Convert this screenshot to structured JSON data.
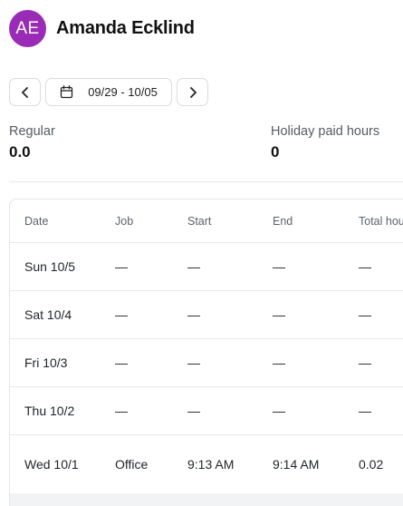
{
  "employee": {
    "initials": "AE",
    "name": "Amanda Ecklind",
    "avatar_color": "#9a2bb7"
  },
  "date_nav": {
    "prev_icon": "chevron-left-icon",
    "next_icon": "chevron-right-icon",
    "calendar_icon": "calendar-icon",
    "range": "09/29 - 10/05"
  },
  "summary": {
    "regular_label": "Regular",
    "regular_value": "0.0",
    "holiday_label": "Holiday paid hours",
    "holiday_value": "0"
  },
  "table": {
    "columns": [
      "Date",
      "Job",
      "Start",
      "End",
      "Total hou"
    ],
    "rows": [
      {
        "date": "Sun 10/5",
        "job": "—",
        "start": "—",
        "end": "—",
        "total": "—"
      },
      {
        "date": "Sat 10/4",
        "job": "—",
        "start": "—",
        "end": "—",
        "total": "—"
      },
      {
        "date": "Fri 10/3",
        "job": "—",
        "start": "—",
        "end": "—",
        "total": "—"
      },
      {
        "date": "Thu 10/2",
        "job": "—",
        "start": "—",
        "end": "—",
        "total": "—"
      },
      {
        "date": "Wed 10/1",
        "job": "Office",
        "start": "9:13 AM",
        "end": "9:14 AM",
        "total": "0.02"
      }
    ]
  }
}
